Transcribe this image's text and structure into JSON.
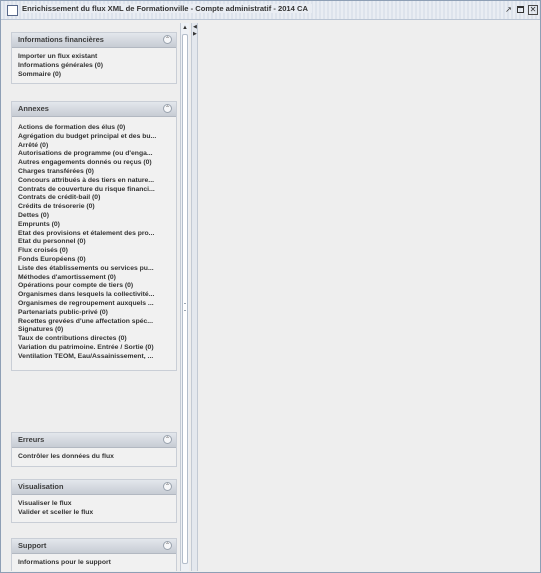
{
  "window": {
    "title": "Enrichissement du flux XML de Formationville - Compte administratif - 2014 CA"
  },
  "sections": {
    "informations": {
      "title": "Informations financières",
      "items": [
        "Importer un flux existant",
        "Informations générales (0)",
        "Sommaire (0)"
      ]
    },
    "annexes": {
      "title": "Annexes",
      "items": [
        "Actions de formation des élus (0)",
        "Agrégation du budget principal et des bu...",
        "Arrêté (0)",
        "Autorisations de programme (ou d'enga...",
        "Autres engagements donnés ou reçus (0)",
        "Charges transférées (0)",
        "Concours attribués à des tiers en nature...",
        "Contrats de couverture du risque financi...",
        "Contrats de crédit-bail (0)",
        "Crédits de trésorerie (0)",
        "Dettes (0)",
        "Emprunts (0)",
        "Etat des provisions et étalement des pro...",
        "Etat du personnel (0)",
        "Flux croisés (0)",
        "Fonds Européens (0)",
        "Liste des établissements ou services pu...",
        "Méthodes d'amortissement (0)",
        "Opérations pour compte de tiers (0)",
        "Organismes dans lesquels la collectivité...",
        "Organismes de regroupement auxquels ...",
        "Partenariats public-privé (0)",
        "Recettes grevées d'une affectation spéc...",
        "Signatures (0)",
        "Taux de contributions directes (0)",
        "Variation du patrimoine. Entrée / Sortie (0)",
        "Ventilation TEOM, Eau/Assainissement, ..."
      ]
    },
    "erreurs": {
      "title": "Erreurs",
      "items": [
        "Contrôler les données du flux"
      ]
    },
    "visualisation": {
      "title": "Visualisation",
      "items": [
        "Visualiser le flux",
        "Valider et sceller le flux"
      ]
    },
    "support": {
      "title": "Support",
      "items": [
        "Informations pour le support"
      ]
    }
  },
  "icons": {
    "window_check": "checkbox-icon",
    "minimize": "minimize-icon",
    "maximize": "maximize-icon",
    "close": "close-icon",
    "collapse": "chevron-up-double-icon",
    "scroll_up": "arrow-up-icon"
  }
}
